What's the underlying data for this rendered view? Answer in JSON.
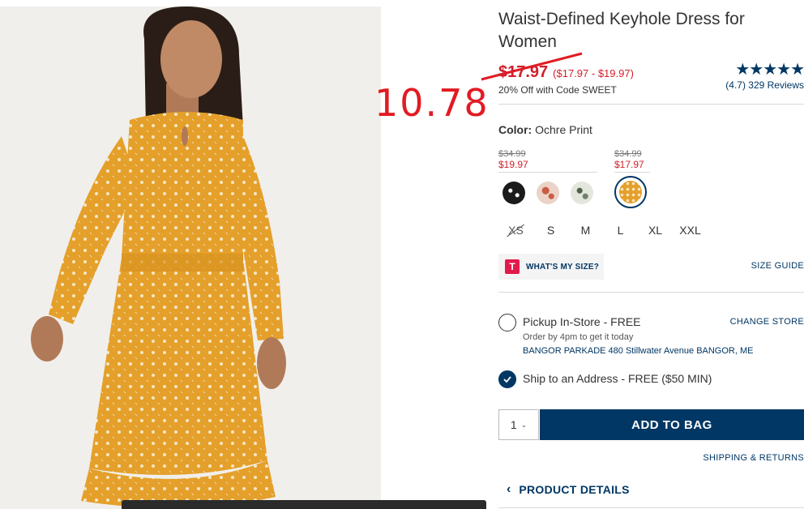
{
  "product": {
    "title": "Waist-Defined Keyhole Dress for Women",
    "price": "$17.97",
    "price_range": "($17.97 - $19.97)",
    "promo": "20% Off with Code SWEET",
    "rating_stars": "★★★★★",
    "reviews": "(4.7) 329 Reviews"
  },
  "annotation": {
    "handwritten_price": "10.78"
  },
  "color": {
    "label": "Color:",
    "value": "Ochre Print",
    "groups": [
      {
        "old_price": "$34.99",
        "new_price": "$19.97"
      },
      {
        "old_price": "$34.99",
        "new_price": "$17.97"
      }
    ],
    "swatches": [
      "#1b1b1b",
      "#e9c3b6",
      "#d8ddd3",
      "#e4a02a"
    ]
  },
  "sizes": [
    "XS",
    "S",
    "M",
    "L",
    "XL",
    "XXL"
  ],
  "fit": {
    "whats_my_size": "WHAT'S MY SIZE?",
    "t_badge": "T",
    "size_guide": "SIZE GUIDE"
  },
  "fulfillment": {
    "pickup_title": "Pickup In-Store - FREE",
    "pickup_sub": "Order by 4pm to get it today",
    "pickup_store": "BANGOR PARKADE 480 Stillwater Avenue  BANGOR, ME",
    "change_store": "CHANGE STORE",
    "ship_title": "Ship to an Address - FREE ($50 MIN)"
  },
  "purchase": {
    "qty": "1",
    "add_to_bag": "ADD TO BAG",
    "shipping_returns": "SHIPPING & RETURNS",
    "product_details": "PRODUCT DETAILS"
  },
  "colors": {
    "brand_navy": "#003764",
    "sale_red": "#d21f2a",
    "annotation_red": "#e21b23",
    "dress_ochre": "#e4a02a"
  }
}
